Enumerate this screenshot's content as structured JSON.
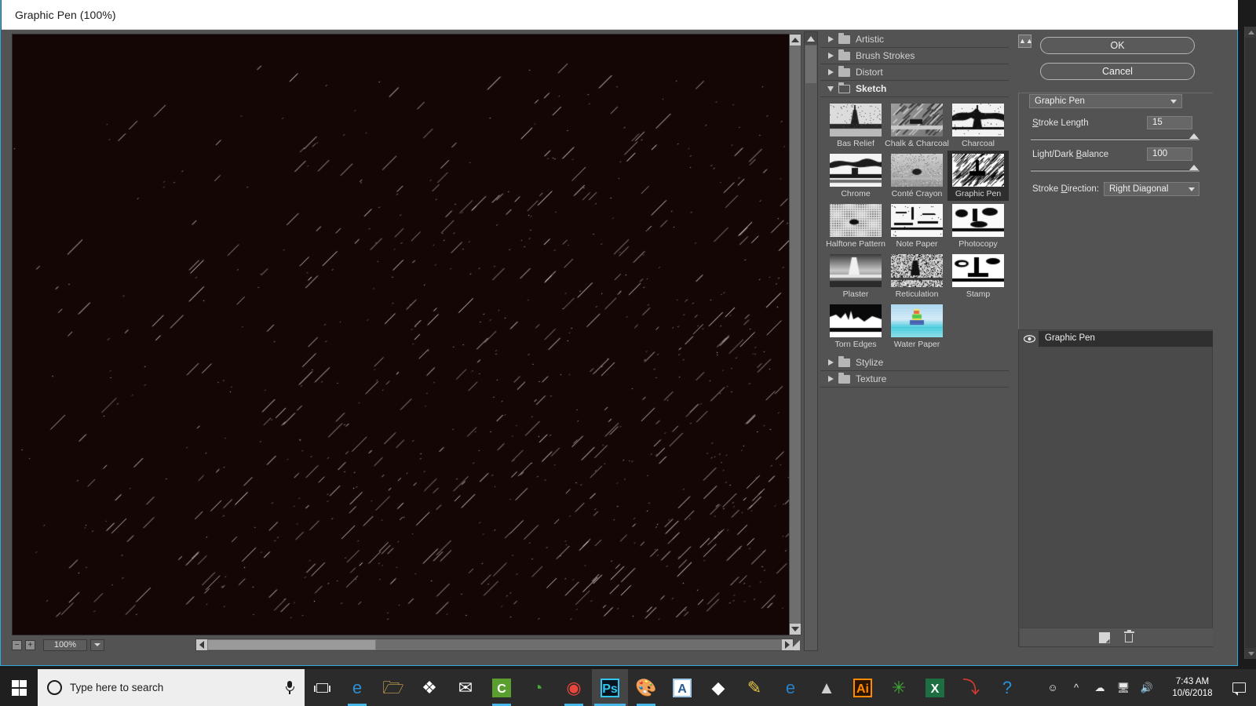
{
  "window": {
    "title": "Graphic Pen (100%)",
    "accent_color": "#2fa8e0"
  },
  "preview": {
    "zoom_out_label": "−",
    "zoom_in_label": "+",
    "zoom_value": "100%",
    "canvas_bg_color": "#140605",
    "stroke_color": "#f7ece0"
  },
  "filter_list": {
    "categories": [
      {
        "label": "Artistic",
        "expanded": false
      },
      {
        "label": "Brush Strokes",
        "expanded": false
      },
      {
        "label": "Distort",
        "expanded": false
      },
      {
        "label": "Sketch",
        "expanded": true
      },
      {
        "label": "Stylize",
        "expanded": false
      },
      {
        "label": "Texture",
        "expanded": false
      }
    ],
    "sketch_filters": [
      {
        "label": "Bas Relief",
        "selected": false,
        "style": "bas-relief"
      },
      {
        "label": "Chalk & Charcoal",
        "selected": false,
        "style": "chalk-charcoal"
      },
      {
        "label": "Charcoal",
        "selected": false,
        "style": "charcoal"
      },
      {
        "label": "Chrome",
        "selected": false,
        "style": "chrome"
      },
      {
        "label": "Conté Crayon",
        "selected": false,
        "style": "conte-crayon"
      },
      {
        "label": "Graphic Pen",
        "selected": true,
        "style": "graphic-pen"
      },
      {
        "label": "Halftone Pattern",
        "selected": false,
        "style": "halftone"
      },
      {
        "label": "Note Paper",
        "selected": false,
        "style": "note-paper"
      },
      {
        "label": "Photocopy",
        "selected": false,
        "style": "photocopy"
      },
      {
        "label": "Plaster",
        "selected": false,
        "style": "plaster"
      },
      {
        "label": "Reticulation",
        "selected": false,
        "style": "reticulation"
      },
      {
        "label": "Stamp",
        "selected": false,
        "style": "stamp"
      },
      {
        "label": "Torn Edges",
        "selected": false,
        "style": "torn-edges"
      },
      {
        "label": "Water Paper",
        "selected": false,
        "style": "water-paper"
      }
    ]
  },
  "settings": {
    "ok_label": "OK",
    "cancel_label": "Cancel",
    "filter_name": "Graphic Pen",
    "stroke_length_label": "Stroke Length",
    "stroke_length_value": "15",
    "stroke_length_min": 1,
    "stroke_length_max": 15,
    "light_dark_label": "Light/Dark Balance",
    "light_dark_value": "100",
    "light_dark_min": 0,
    "light_dark_max": 100,
    "stroke_direction_label": "Stroke Direction:",
    "stroke_direction_value": "Right Diagonal"
  },
  "layers": {
    "items": [
      {
        "name": "Graphic Pen",
        "visible": true
      }
    ],
    "new_layer_tooltip": "new-effect-layer",
    "delete_tooltip": "delete-effect-layer"
  },
  "taskbar": {
    "search_placeholder": "Type here to search",
    "time": "7:43 AM",
    "date": "10/6/2018",
    "apps": [
      {
        "name": "microsoft-edge",
        "glyph": "e",
        "color": "#2b8fd6",
        "running": true
      },
      {
        "name": "file-explorer",
        "glyph": "🗁",
        "color": "#f5c45a",
        "running": false
      },
      {
        "name": "dropbox",
        "glyph": "❖",
        "color": "#ffffff",
        "running": false
      },
      {
        "name": "mail",
        "glyph": "✉",
        "color": "#ffffff",
        "running": false
      },
      {
        "name": "camtasia",
        "glyph": "C",
        "color": "#5a9e2f",
        "running": true
      },
      {
        "name": "internet-download-manager",
        "glyph": "◔",
        "color": "#4aa83c",
        "running": false
      },
      {
        "name": "google-chrome",
        "glyph": "◉",
        "color": "#e8453c",
        "running": true
      },
      {
        "name": "adobe-photoshop",
        "glyph": "Ps",
        "color": "#31c5f0",
        "running": true,
        "active": true
      },
      {
        "name": "paint",
        "glyph": "🎨",
        "color": "#d4a96a",
        "running": true
      },
      {
        "name": "wordpad",
        "glyph": "A",
        "color": "#cfe3f5",
        "running": false
      },
      {
        "name": "media-player",
        "glyph": "◆",
        "color": "#ffffff",
        "running": false
      },
      {
        "name": "picture-manager",
        "glyph": "✎",
        "color": "#e6c24a",
        "running": false
      },
      {
        "name": "internet-explorer",
        "glyph": "e",
        "color": "#2a7fc9",
        "running": false
      },
      {
        "name": "inkscape",
        "glyph": "▲",
        "color": "#cfcfcf",
        "running": false
      },
      {
        "name": "adobe-illustrator",
        "glyph": "Ai",
        "color": "#ff8a00",
        "running": false
      },
      {
        "name": "corel-draw",
        "glyph": "✳",
        "color": "#3faa35",
        "running": false
      },
      {
        "name": "microsoft-excel",
        "glyph": "X",
        "color": "#1d6f42",
        "running": false
      },
      {
        "name": "adobe-acrobat",
        "glyph": "⤵",
        "color": "#e03b2f",
        "running": false
      },
      {
        "name": "help-support",
        "glyph": "?",
        "color": "#2b8fd6",
        "running": false
      }
    ],
    "tray": [
      {
        "name": "people-icon",
        "glyph": "⚹"
      },
      {
        "name": "show-hidden-icons-icon",
        "glyph": "⌃"
      },
      {
        "name": "onedrive-icon",
        "glyph": "☁"
      },
      {
        "name": "network-icon",
        "glyph": "὚5"
      },
      {
        "name": "volume-icon",
        "glyph": "🔊"
      }
    ]
  }
}
